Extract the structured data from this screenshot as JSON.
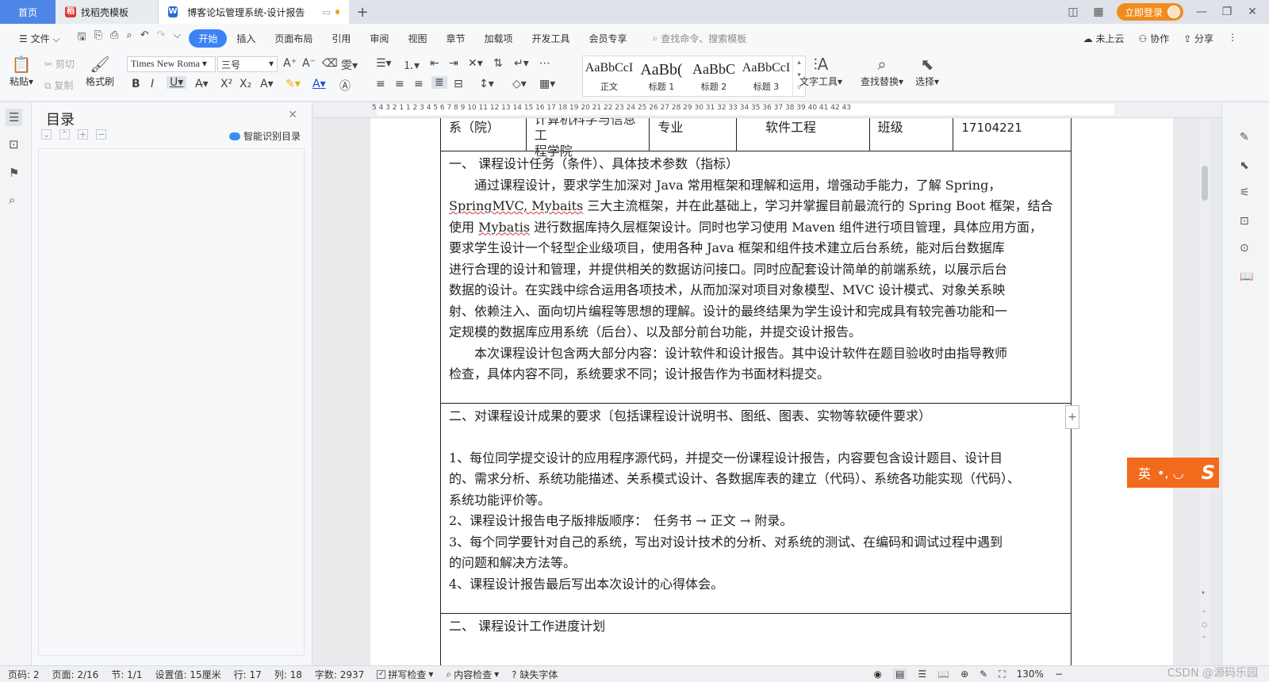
{
  "tabs": {
    "home": "首页",
    "template": "找稻壳模板",
    "doc": "博客论坛管理系统-设计报告",
    "login": "立即登录"
  },
  "menu": {
    "file": "文件",
    "items": [
      "开始",
      "插入",
      "页面布局",
      "引用",
      "审阅",
      "视图",
      "章节",
      "加载项",
      "开发工具",
      "会员专享"
    ],
    "search_placeholder": "查找命令、搜索模板",
    "cloud": "未上云",
    "collab": "协作",
    "share": "分享"
  },
  "ribbon": {
    "paste": "粘贴",
    "cut": "剪切",
    "copy": "复制",
    "format_painter": "格式刷",
    "font_name": "Times New Roma",
    "font_size": "三号",
    "styles": [
      {
        "sample": "AaBbCcI",
        "label": "正文"
      },
      {
        "sample": "AaBb(",
        "label": "标题 1"
      },
      {
        "sample": "AaBbC",
        "label": "标题 2"
      },
      {
        "sample": "AaBbCcI",
        "label": "标题 3"
      }
    ],
    "text_tools": "文字工具",
    "find_replace": "查找替换",
    "select": "选择"
  },
  "toc": {
    "title": "目录",
    "smart": "智能识别目录"
  },
  "ruler_nums": "5 4 3 2 1 1 2 3 4 5 6 7 8 9 10 11 12 13 14 15 16 17 18 19 20 21 22 23 24 25 26 27 28 29 30 31 32 33 34 35 36 37 38 39 40 41 42 43",
  "document": {
    "header_row": {
      "c1": "系（院）",
      "c2a": "计算机科学与信息工",
      "c2b": "程学院",
      "c3": "专业",
      "c4": "软件工程",
      "c5": "班级",
      "c6": "17104221"
    },
    "section1": {
      "title": "一、 课程设计任务（条件）、具体技术参数（指标）",
      "p1": "通过课程设计，要求学生加深对 Java 常用框架和理解和运用，增强动手能力，了解 Spring，",
      "p1_ul": "SpringMVC, Mybaits",
      "p1b": " 三大主流框架，并在此基础上，学习并掌握目前最流行的 Spring Boot 框架，结合",
      "p1c_pre": "使用 ",
      "p1c_ul": "Mybatis",
      "p1c_post": " 进行数据库持久层框架设计。同时也学习使用 Maven 组件进行项目管理，具体应用方面，",
      "p1d": "要求学生设计一个轻型企业级项目，使用各种 Java 框架和组件技术建立后台系统，能对后台数据库",
      "p1e": "进行合理的设计和管理，并提供相关的数据访问接口。同时应配套设计简单的前端系统，以展示后台",
      "p1f": "数据的设计。在实践中综合运用各项技术，从而加深对项目对象模型、MVC 设计模式、对象关系映",
      "p1g": "射、依赖注入、面向切片编程等思想的理解。设计的最终结果为学生设计和完成具有较完善功能和一",
      "p1h": "定规模的数据库应用系统（后台）、以及部分前台功能，并提交设计报告。",
      "p2": "本次课程设计包含两大部分内容：设计软件和设计报告。其中设计软件在题目验收时由指导教师",
      "p2b": "检查，具体内容不同，系统要求不同；设计报告作为书面材料提交。"
    },
    "section2": {
      "title": "二、对课程设计成果的要求〔包括课程设计说明书、图纸、图表、实物等软硬件要求）",
      "i1a": "1、每位同学提交设计的应用程序源代码，并提交一份课程设计报告，内容要包含设计题目、设计目",
      "i1b": "的、需求分析、系统功能描述、关系模式设计、各数据库表的建立（代码）、系统各功能实现（代码）、",
      "i1c": "系统功能评价等。",
      "i2": "2、课程设计报告电子版排版顺序：　任务书 → 正文 → 附录。",
      "i3a": "3、每个同学要针对自己的系统，写出对设计技术的分析、对系统的测试、在编码和调试过程中遇到",
      "i3b": "的问题和解决方法等。",
      "i4": "4、课程设计报告最后写出本次设计的心得体会。"
    },
    "section3": {
      "title": "二、 课程设计工作进度计划"
    }
  },
  "ime": {
    "lang": "英",
    "punct": "•, ◡"
  },
  "status": {
    "page_no": "页码: 2",
    "pages": "页面: 2/16",
    "section": "节: 1/1",
    "setting": "设置值: 15厘米",
    "line": "行: 17",
    "col": "列: 18",
    "words": "字数: 2937",
    "spell": "拼写检查",
    "content": "内容检查",
    "missing_font": "缺失字体",
    "zoom": "130%",
    "watermark": "CSDN @源码乐园"
  }
}
